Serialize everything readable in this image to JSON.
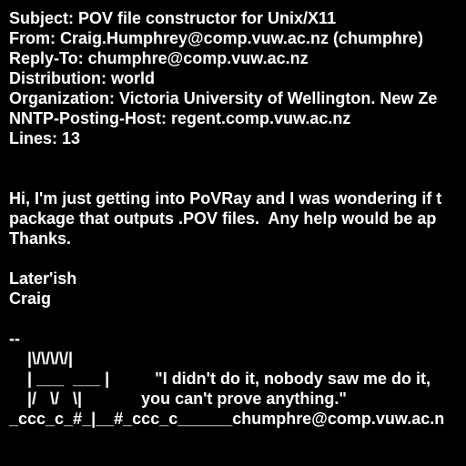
{
  "colors": {
    "background": "#000000",
    "text": "#ffffff"
  },
  "header": {
    "subject": "Subject: POV file constructor for Unix/X11",
    "from": "From: Craig.Humphrey@comp.vuw.ac.nz (chumphre)",
    "reply_to": "Reply-To: chumphre@comp.vuw.ac.nz",
    "distribution": "Distribution: world",
    "organization": "Organization: Victoria University of Wellington. New Ze",
    "nntp_posting_host": "NNTP-Posting-Host: regent.comp.vuw.ac.nz",
    "lines": "Lines: 13"
  },
  "body": {
    "line1": "Hi, I'm just getting into PoVRay and I was wondering if t",
    "line2": "package that outputs .POV files.  Any help would be ap",
    "line3": "Thanks.",
    "closing1": "Later'ish",
    "closing2": "Craig"
  },
  "signature": {
    "separator": "--",
    "art1": "    |\\/\\/\\/\\/|",
    "art2": "    | ___  ___ |          \"I didn't do it, nobody saw me do it,",
    "art3": "    |/   \\/   \\|             you can't prove anything.\"",
    "art4": "_ccc_c_#_|__#_ccc_c______chumphre@comp.vuw.ac.n"
  }
}
